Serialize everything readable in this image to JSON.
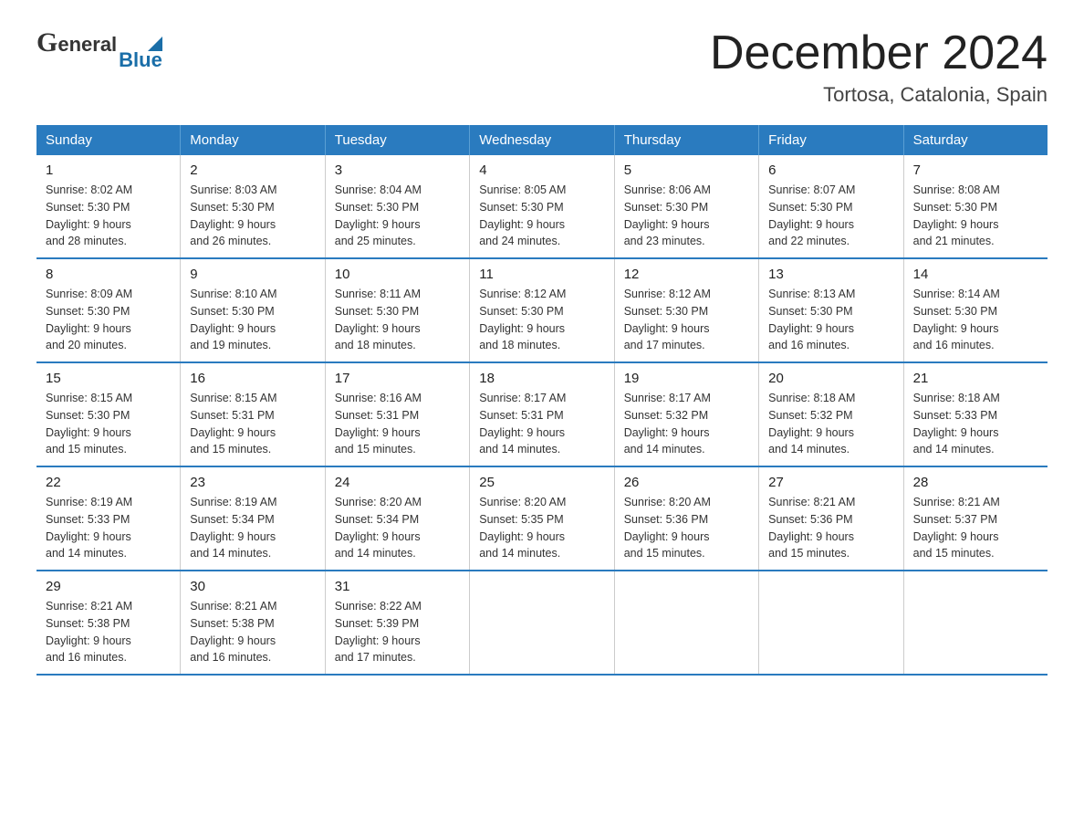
{
  "logo": {
    "general": "General",
    "blue": "Blue",
    "triangle_color": "#1a6ea8"
  },
  "header": {
    "month_year": "December 2024",
    "location": "Tortosa, Catalonia, Spain"
  },
  "weekdays": [
    "Sunday",
    "Monday",
    "Tuesday",
    "Wednesday",
    "Thursday",
    "Friday",
    "Saturday"
  ],
  "weeks": [
    [
      {
        "day": "1",
        "sunrise": "8:02 AM",
        "sunset": "5:30 PM",
        "daylight": "9 hours and 28 minutes."
      },
      {
        "day": "2",
        "sunrise": "8:03 AM",
        "sunset": "5:30 PM",
        "daylight": "9 hours and 26 minutes."
      },
      {
        "day": "3",
        "sunrise": "8:04 AM",
        "sunset": "5:30 PM",
        "daylight": "9 hours and 25 minutes."
      },
      {
        "day": "4",
        "sunrise": "8:05 AM",
        "sunset": "5:30 PM",
        "daylight": "9 hours and 24 minutes."
      },
      {
        "day": "5",
        "sunrise": "8:06 AM",
        "sunset": "5:30 PM",
        "daylight": "9 hours and 23 minutes."
      },
      {
        "day": "6",
        "sunrise": "8:07 AM",
        "sunset": "5:30 PM",
        "daylight": "9 hours and 22 minutes."
      },
      {
        "day": "7",
        "sunrise": "8:08 AM",
        "sunset": "5:30 PM",
        "daylight": "9 hours and 21 minutes."
      }
    ],
    [
      {
        "day": "8",
        "sunrise": "8:09 AM",
        "sunset": "5:30 PM",
        "daylight": "9 hours and 20 minutes."
      },
      {
        "day": "9",
        "sunrise": "8:10 AM",
        "sunset": "5:30 PM",
        "daylight": "9 hours and 19 minutes."
      },
      {
        "day": "10",
        "sunrise": "8:11 AM",
        "sunset": "5:30 PM",
        "daylight": "9 hours and 18 minutes."
      },
      {
        "day": "11",
        "sunrise": "8:12 AM",
        "sunset": "5:30 PM",
        "daylight": "9 hours and 18 minutes."
      },
      {
        "day": "12",
        "sunrise": "8:12 AM",
        "sunset": "5:30 PM",
        "daylight": "9 hours and 17 minutes."
      },
      {
        "day": "13",
        "sunrise": "8:13 AM",
        "sunset": "5:30 PM",
        "daylight": "9 hours and 16 minutes."
      },
      {
        "day": "14",
        "sunrise": "8:14 AM",
        "sunset": "5:30 PM",
        "daylight": "9 hours and 16 minutes."
      }
    ],
    [
      {
        "day": "15",
        "sunrise": "8:15 AM",
        "sunset": "5:30 PM",
        "daylight": "9 hours and 15 minutes."
      },
      {
        "day": "16",
        "sunrise": "8:15 AM",
        "sunset": "5:31 PM",
        "daylight": "9 hours and 15 minutes."
      },
      {
        "day": "17",
        "sunrise": "8:16 AM",
        "sunset": "5:31 PM",
        "daylight": "9 hours and 15 minutes."
      },
      {
        "day": "18",
        "sunrise": "8:17 AM",
        "sunset": "5:31 PM",
        "daylight": "9 hours and 14 minutes."
      },
      {
        "day": "19",
        "sunrise": "8:17 AM",
        "sunset": "5:32 PM",
        "daylight": "9 hours and 14 minutes."
      },
      {
        "day": "20",
        "sunrise": "8:18 AM",
        "sunset": "5:32 PM",
        "daylight": "9 hours and 14 minutes."
      },
      {
        "day": "21",
        "sunrise": "8:18 AM",
        "sunset": "5:33 PM",
        "daylight": "9 hours and 14 minutes."
      }
    ],
    [
      {
        "day": "22",
        "sunrise": "8:19 AM",
        "sunset": "5:33 PM",
        "daylight": "9 hours and 14 minutes."
      },
      {
        "day": "23",
        "sunrise": "8:19 AM",
        "sunset": "5:34 PM",
        "daylight": "9 hours and 14 minutes."
      },
      {
        "day": "24",
        "sunrise": "8:20 AM",
        "sunset": "5:34 PM",
        "daylight": "9 hours and 14 minutes."
      },
      {
        "day": "25",
        "sunrise": "8:20 AM",
        "sunset": "5:35 PM",
        "daylight": "9 hours and 14 minutes."
      },
      {
        "day": "26",
        "sunrise": "8:20 AM",
        "sunset": "5:36 PM",
        "daylight": "9 hours and 15 minutes."
      },
      {
        "day": "27",
        "sunrise": "8:21 AM",
        "sunset": "5:36 PM",
        "daylight": "9 hours and 15 minutes."
      },
      {
        "day": "28",
        "sunrise": "8:21 AM",
        "sunset": "5:37 PM",
        "daylight": "9 hours and 15 minutes."
      }
    ],
    [
      {
        "day": "29",
        "sunrise": "8:21 AM",
        "sunset": "5:38 PM",
        "daylight": "9 hours and 16 minutes."
      },
      {
        "day": "30",
        "sunrise": "8:21 AM",
        "sunset": "5:38 PM",
        "daylight": "9 hours and 16 minutes."
      },
      {
        "day": "31",
        "sunrise": "8:22 AM",
        "sunset": "5:39 PM",
        "daylight": "9 hours and 17 minutes."
      },
      null,
      null,
      null,
      null
    ]
  ],
  "labels": {
    "sunrise": "Sunrise:",
    "sunset": "Sunset:",
    "daylight": "Daylight:"
  }
}
